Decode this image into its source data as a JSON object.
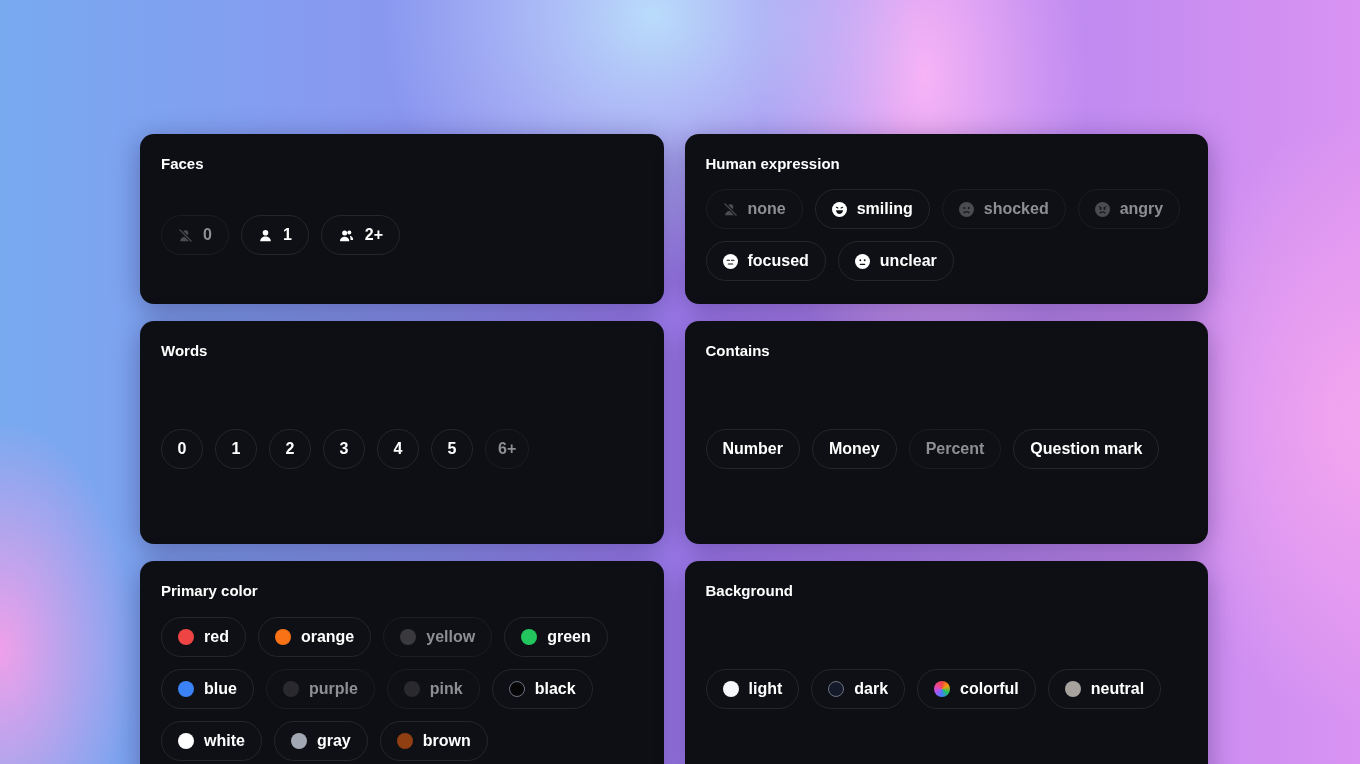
{
  "faces": {
    "title": "Faces",
    "options": [
      {
        "label": "0",
        "kind": "none",
        "disabled": true
      },
      {
        "label": "1",
        "kind": "person",
        "disabled": false
      },
      {
        "label": "2+",
        "kind": "group",
        "disabled": false
      }
    ]
  },
  "human_expression": {
    "title": "Human expression",
    "options": [
      {
        "label": "none",
        "kind": "none",
        "disabled": true
      },
      {
        "label": "smiling",
        "kind": "smiling",
        "disabled": false
      },
      {
        "label": "shocked",
        "kind": "shocked",
        "disabled": true
      },
      {
        "label": "angry",
        "kind": "angry",
        "disabled": true
      },
      {
        "label": "focused",
        "kind": "focused",
        "disabled": false
      },
      {
        "label": "unclear",
        "kind": "unclear",
        "disabled": false
      }
    ]
  },
  "words": {
    "title": "Words",
    "options": [
      {
        "label": "0",
        "disabled": false
      },
      {
        "label": "1",
        "disabled": false
      },
      {
        "label": "2",
        "disabled": false
      },
      {
        "label": "3",
        "disabled": false
      },
      {
        "label": "4",
        "disabled": false
      },
      {
        "label": "5",
        "disabled": false
      },
      {
        "label": "6+",
        "disabled": true
      }
    ]
  },
  "contains": {
    "title": "Contains",
    "options": [
      {
        "label": "Number",
        "disabled": false
      },
      {
        "label": "Money",
        "disabled": false
      },
      {
        "label": "Percent",
        "disabled": true
      },
      {
        "label": "Question mark",
        "disabled": false
      }
    ]
  },
  "primary_color": {
    "title": "Primary color",
    "options": [
      {
        "label": "red",
        "color": "#ef4444",
        "disabled": false
      },
      {
        "label": "orange",
        "color": "#f97316",
        "disabled": false
      },
      {
        "label": "yellow",
        "color": "#3a3a3e",
        "disabled": true
      },
      {
        "label": "green",
        "color": "#22c55e",
        "disabled": false
      },
      {
        "label": "blue",
        "color": "#3b82f6",
        "disabled": false
      },
      {
        "label": "purple",
        "color": "#2a2a2e",
        "disabled": true
      },
      {
        "label": "pink",
        "color": "#2a2a2e",
        "disabled": true
      },
      {
        "label": "black",
        "color": "#050505",
        "disabled": false
      },
      {
        "label": "white",
        "color": "#ffffff",
        "disabled": false
      },
      {
        "label": "gray",
        "color": "#a1a7b3",
        "disabled": false
      },
      {
        "label": "brown",
        "color": "#8f3f12",
        "disabled": false
      }
    ]
  },
  "background": {
    "title": "Background",
    "options": [
      {
        "label": "light",
        "kind": "solid",
        "color": "#f5f7fb",
        "disabled": false
      },
      {
        "label": "dark",
        "kind": "solid",
        "color": "#141a2a",
        "disabled": false
      },
      {
        "label": "colorful",
        "kind": "multicolor",
        "disabled": false
      },
      {
        "label": "neutral",
        "kind": "solid",
        "color": "#a8a29e",
        "disabled": false
      }
    ]
  }
}
